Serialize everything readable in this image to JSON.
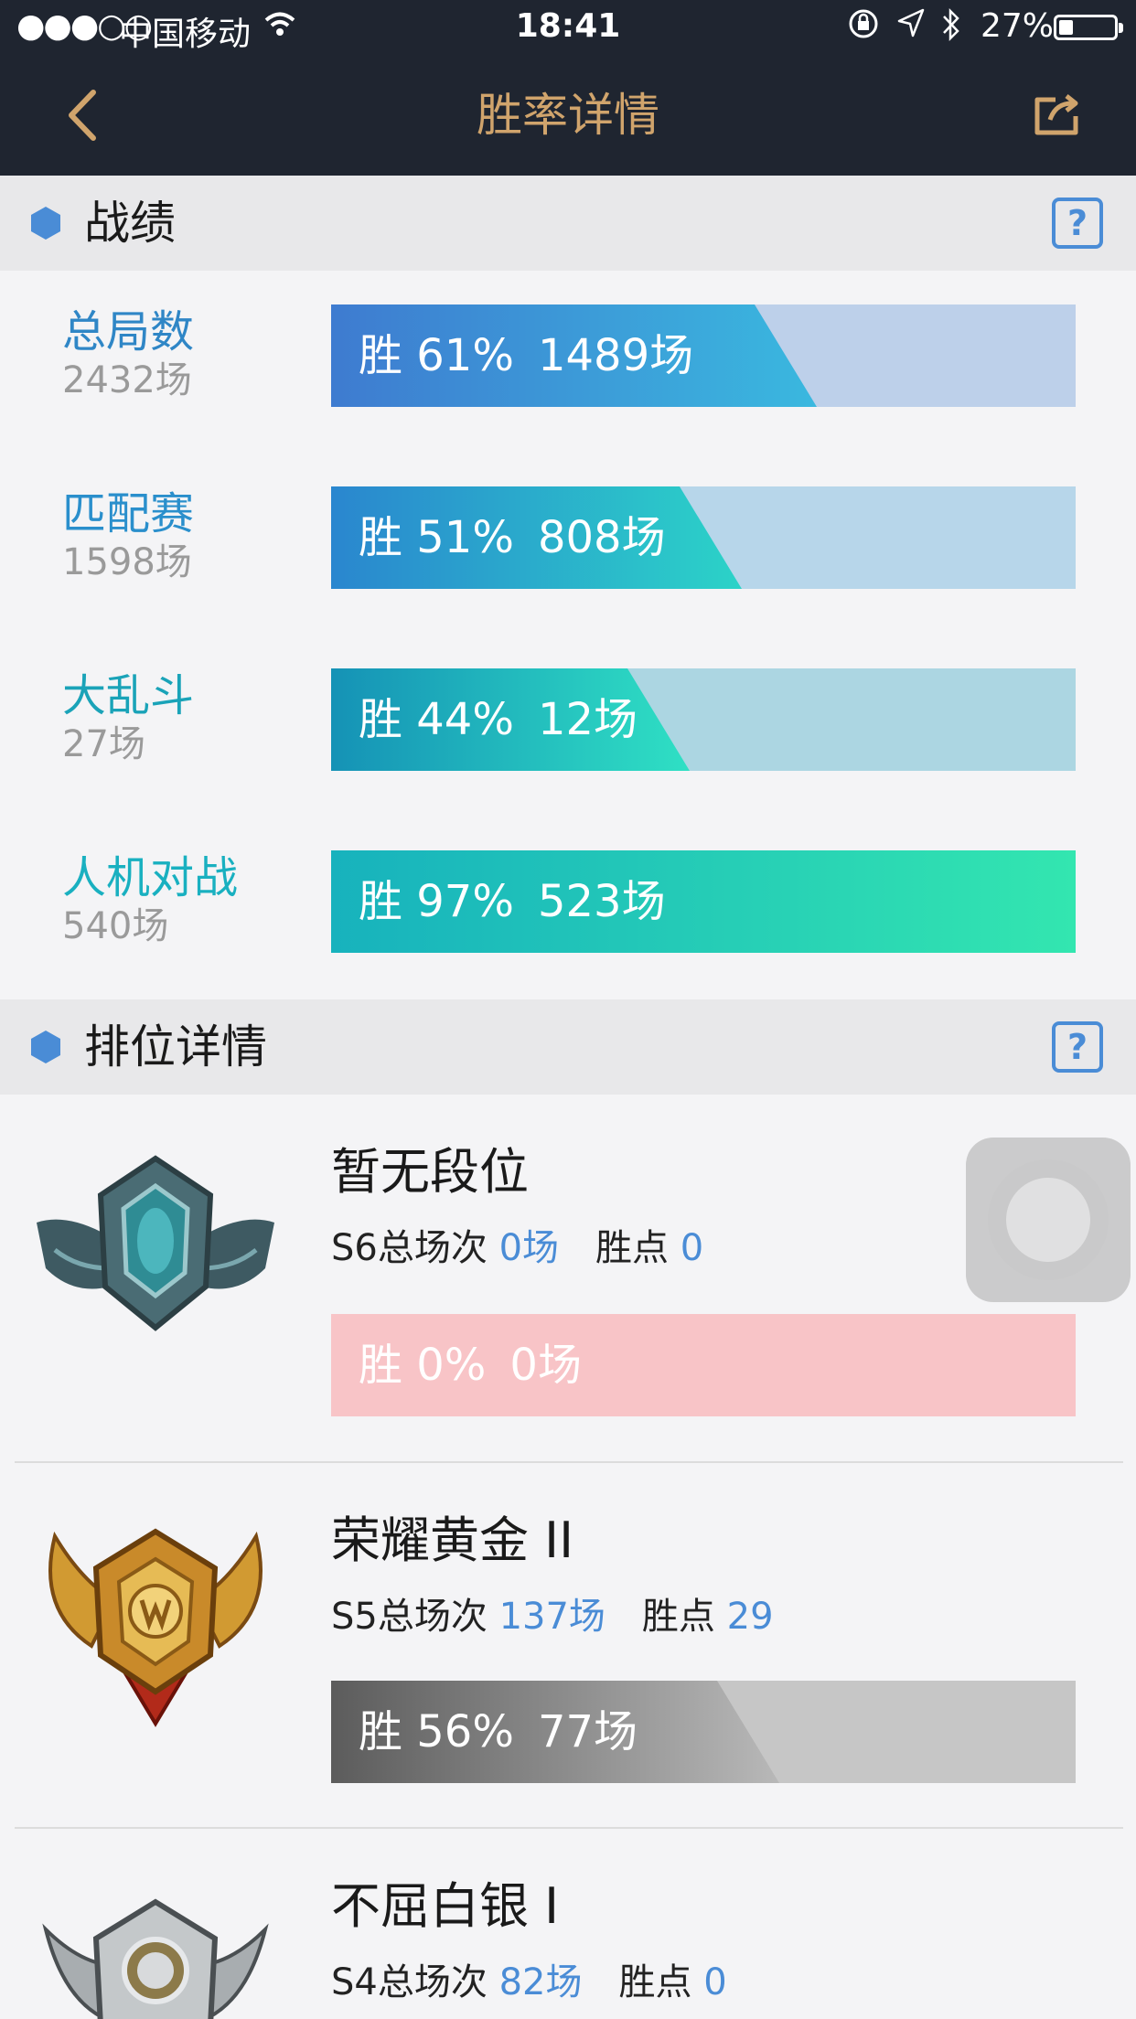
{
  "status_bar": {
    "signal": "●●●○○",
    "carrier": "中国移动",
    "time": "18:41",
    "battery": "27%"
  },
  "nav": {
    "title": "胜率详情"
  },
  "sections": {
    "record_title": "战绩",
    "rank_title": "排位详情",
    "help_label": "?"
  },
  "stats": [
    {
      "label": "总局数",
      "count": "2432场",
      "win": "胜 61%",
      "wins": "1489场",
      "ratio": 0.61,
      "label_color": "#2f86c6",
      "from": "#3e7bd0",
      "to": "#3ab8df",
      "track": "#bdd0ea"
    },
    {
      "label": "匹配赛",
      "count": "1598场",
      "win": "胜 51%",
      "wins": "808场",
      "ratio": 0.51,
      "label_color": "#2a8fcc",
      "from": "#2a86cf",
      "to": "#2bd3c8",
      "track": "#b7d6ea"
    },
    {
      "label": "大乱斗",
      "count": "27场",
      "win": "胜 44%",
      "wins": "12场",
      "ratio": 0.44,
      "label_color": "#1aa3b8",
      "from": "#1592b6",
      "to": "#2fe0c4",
      "track": "#acd6e2"
    },
    {
      "label": "人机对战",
      "count": "540场",
      "win": "胜 97%",
      "wins": "523场",
      "ratio": 0.97,
      "label_color": "#19b0c0",
      "from": "#17b2bd",
      "to": "#33e6b0",
      "track": "#abdee2"
    }
  ],
  "ranks": [
    {
      "title": "暂无段位",
      "season_label": "S6总场次",
      "season_count": "0场",
      "points_label": "胜点",
      "points": "0",
      "win": "胜 0%",
      "wins": "0场",
      "ratio": 0,
      "track": "#f8c4c7",
      "from": "#f8c4c7",
      "to": "#f8c4c7",
      "emblem": "unranked"
    },
    {
      "title": "荣耀黄金 II",
      "season_label": "S5总场次",
      "season_count": "137场",
      "points_label": "胜点",
      "points": "29",
      "win": "胜 56%",
      "wins": "77场",
      "ratio": 0.56,
      "track": "#c6c6c6",
      "from": "#5c5c5c",
      "to": "#b8b8b8",
      "emblem": "gold"
    },
    {
      "title": "不屈白银 I",
      "season_label": "S4总场次",
      "season_count": "82场",
      "points_label": "胜点",
      "points": "0",
      "emblem": "silver"
    }
  ]
}
